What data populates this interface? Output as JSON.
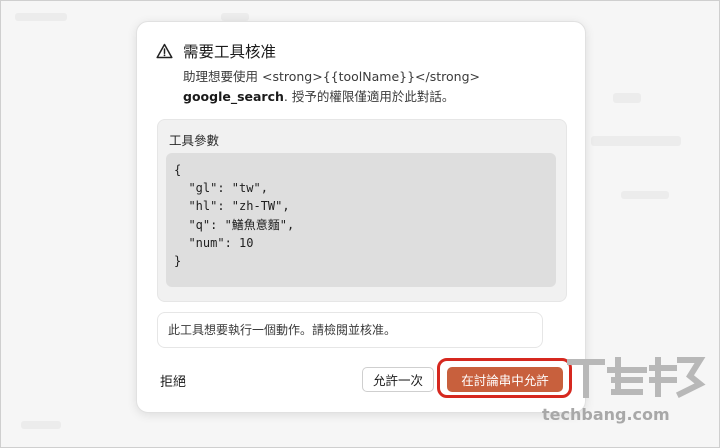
{
  "dialog": {
    "title": "需要工具核准",
    "description_prefix": "助理想要使用 <strong>{{toolName}}</strong>",
    "tool_name": "google_search",
    "description_suffix": ". 授予的權限僅適用於此對話。",
    "params_label": "工具參數",
    "params_code": "{\n  \"gl\": \"tw\",\n  \"hl\": \"zh-TW\",\n  \"q\": \"鱔魚意麵\",\n  \"num\": 10\n}",
    "notice": "此工具想要執行一個動作。請檢閱並核准。",
    "buttons": {
      "reject": "拒絕",
      "allow_once": "允許一次",
      "allow_in_thread": "在討論串中允許"
    }
  },
  "watermark": {
    "text": "techbang.com"
  },
  "colors": {
    "primary_button": "#c8603d",
    "highlight_outline": "#d6281f"
  },
  "icons": {
    "title_icon": "warning-triangle-icon"
  }
}
